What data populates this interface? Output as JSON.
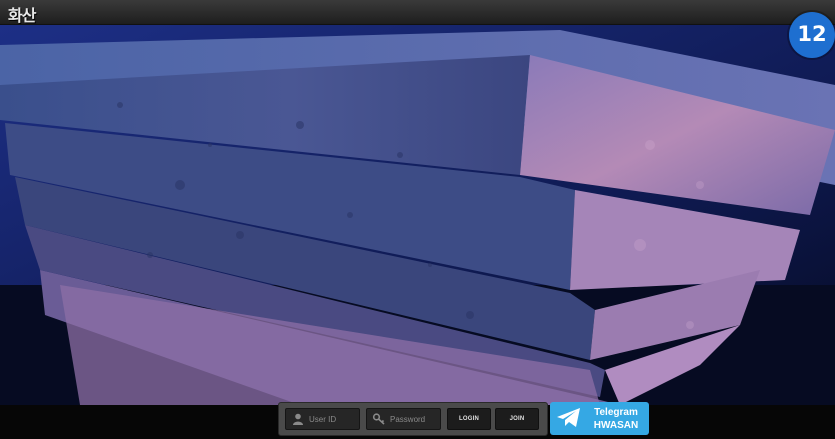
{
  "header": {
    "logo": "화산"
  },
  "badge": {
    "text": "12"
  },
  "login": {
    "user_id_placeholder": "User ID",
    "password_placeholder": "Password",
    "login_label": "LOGIN",
    "join_label": "JOIN"
  },
  "telegram": {
    "line1": "Telegram",
    "line2": "HWASAN"
  },
  "icons": {
    "user": "user-icon",
    "key": "key-icon",
    "telegram": "telegram-plane-icon"
  },
  "colors": {
    "badge": "#1e6fd0",
    "telegram": "#35a8e4"
  }
}
